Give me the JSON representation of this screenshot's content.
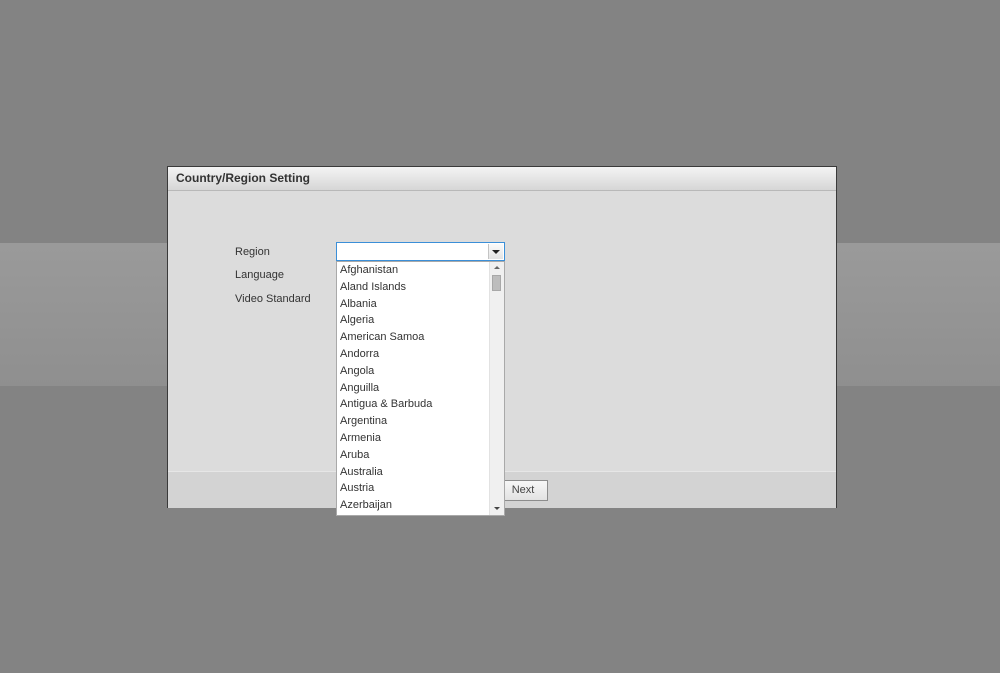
{
  "dialog": {
    "title": "Country/Region Setting",
    "labels": {
      "region": "Region",
      "language": "Language",
      "video_standard": "Video Standard"
    },
    "region_select": {
      "value": ""
    },
    "region_options": [
      "Afghanistan",
      "Aland Islands",
      "Albania",
      "Algeria",
      "American Samoa",
      "Andorra",
      "Angola",
      "Anguilla",
      "Antigua & Barbuda",
      "Argentina",
      "Armenia",
      "Aruba",
      "Australia",
      "Austria",
      "Azerbaijan"
    ],
    "next_button": "Next"
  },
  "colors": {
    "backdrop": "#838383",
    "dialog_bg": "#dcdcdc",
    "select_focus_border": "#3b8fd8"
  },
  "icons": {
    "select_arrow": "chevron-down-icon",
    "scroll_up": "scroll-up-arrow-icon",
    "scroll_down": "scroll-down-arrow-icon"
  }
}
